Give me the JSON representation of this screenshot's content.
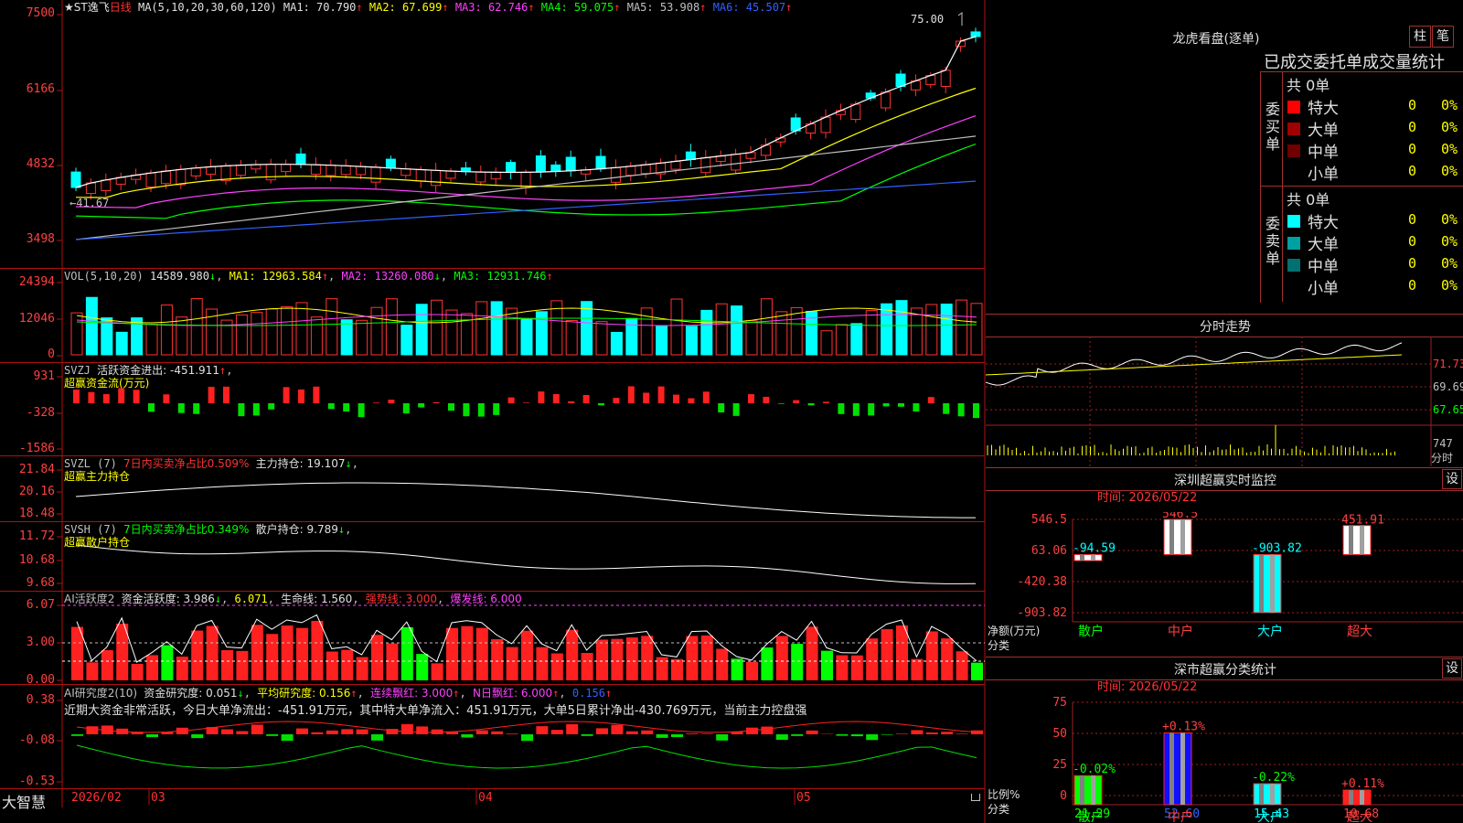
{
  "header": {
    "title": "★ST逸飞",
    "period": "日线",
    "ma_def": "MA(5,10,20,30,60,120)",
    "ma": [
      {
        "label": "MA1: 70.790",
        "arrow": "↑",
        "color": "#ffffff"
      },
      {
        "label": "MA2: 67.699",
        "arrow": "↑",
        "color": "#ffff00"
      },
      {
        "label": "MA3: 62.746",
        "arrow": "↑",
        "color": "#ff40ff"
      },
      {
        "label": "MA4: 59.075",
        "arrow": "↑",
        "color": "#00ff00"
      },
      {
        "label": "MA5: 53.908",
        "arrow": "↑",
        "color": "#c0c0c0"
      },
      {
        "label": "MA6: 45.507",
        "arrow": "↑",
        "color": "#3060ff"
      }
    ],
    "high_mark": "75.00",
    "low_mark": "←41.67"
  },
  "price_axis": [
    "7500",
    "6166",
    "4832",
    "3498"
  ],
  "vol": {
    "label": "VOL(5,10,20)",
    "value": "14589.980",
    "value_arrow": "↓",
    "ma1": "MA1: 12963.584",
    "ma1_arrow": "↑",
    "ma2": "MA2: 13260.080",
    "ma2_arrow": "↓",
    "ma3": "MA3: 12931.746",
    "ma3_arrow": "↑",
    "axis": [
      "24394",
      "12046",
      "0"
    ]
  },
  "svzj": {
    "label": "SVZJ",
    "title": "活跃资金进出: -451.911",
    "arrow": "↑",
    "sub": "超赢资金流(万元)",
    "axis": [
      "931",
      "-328",
      "-1586"
    ]
  },
  "svzl": {
    "label": "SVZL (7)",
    "desc": "7日内买卖净占比0.509%",
    "hold": "主力持仓: 19.107",
    "arrow": "↓",
    "sub": "超赢主力持仓",
    "axis": [
      "21.84",
      "20.16",
      "18.48"
    ]
  },
  "svsh": {
    "label": "SVSH (7)",
    "desc": "7日内买卖净占比0.349%",
    "hold": "散户持仓: 9.789",
    "arrow": "↓",
    "sub": "超赢散户持仓",
    "axis": [
      "11.72",
      "10.68",
      "9.68"
    ]
  },
  "ai_active": {
    "label": "AI活跃度2",
    "act": "资金活跃度: 3.986",
    "act_arrow": "↓",
    "v2": "6.071",
    "life": "生命线: 1.560",
    "strong": "强势线: 3.000",
    "burst": "爆发线: 6.000",
    "axis": [
      "6.07",
      "3.00",
      "0.00"
    ]
  },
  "ai_research": {
    "label": "AI研究度2(10)",
    "research": "资金研究度: 0.051",
    "r_arrow": "↓",
    "avg": "平均研究度: 0.156",
    "avg_arrow": "↑",
    "cont": "连续飘红: 3.000",
    "cont_arrow": "↑",
    "nday": "N日飘红: 6.000",
    "nday_arrow": "↑",
    "last": "0.156",
    "last_arrow": "↑",
    "comment": "近期大资金非常活跃，今日大单净流出：-451.91万元，其中特大单净流入：451.91万元，大单5日累计净出-430.769万元，当前主力控盘强",
    "axis": [
      "0.38",
      "-0.08",
      "-0.53"
    ]
  },
  "footer": {
    "brand": "大智慧",
    "date_labels": [
      "2026/02",
      "03",
      "04",
      "05"
    ]
  },
  "right": {
    "panel_title": "龙虎看盘(逐单)",
    "btn_bar": "柱",
    "btn_pen": "笔",
    "tabs": "已成交委托单成交量统计",
    "buy": {
      "side_label": "委买单",
      "total": "共 0单",
      "rows": [
        {
          "name": "特大",
          "count": "0",
          "pct": "0%",
          "color": "#ff0000"
        },
        {
          "name": "大单",
          "count": "0",
          "pct": "0%",
          "color": "#a00000"
        },
        {
          "name": "中单",
          "count": "0",
          "pct": "0%",
          "color": "#700000"
        },
        {
          "name": "小单",
          "count": "0",
          "pct": "0%",
          "color": "#000000"
        }
      ]
    },
    "sell": {
      "side_label": "委卖单",
      "total": "共 0单",
      "rows": [
        {
          "name": "特大",
          "count": "0",
          "pct": "0%",
          "color": "#00ffff"
        },
        {
          "name": "大单",
          "count": "0",
          "pct": "0%",
          "color": "#00a0a0"
        },
        {
          "name": "中单",
          "count": "0",
          "pct": "0%",
          "color": "#007070"
        },
        {
          "name": "小单",
          "count": "0",
          "pct": "0%",
          "color": "#000000"
        }
      ]
    },
    "intraday": {
      "title": "分时走势",
      "axis": [
        "71.73",
        "69.69",
        "67.65"
      ],
      "vol_axis": "747",
      "unit": "分时"
    },
    "sz_monitor": {
      "title": "深圳超赢实时监控",
      "btn": "设",
      "time": "时间: 2026/05/22",
      "axis": [
        "546.5",
        "63.06",
        "-420.38",
        "-903.82"
      ],
      "ylabel": "净额(万元)",
      "xlabel": "分类",
      "categories": [
        "散户",
        "中户",
        "大户",
        "超大"
      ],
      "values": [
        -94.59,
        546.5,
        -903.82,
        451.91
      ],
      "value_labels": [
        "-94.59",
        "546.5",
        "-903.82",
        "451.91"
      ]
    },
    "sz_class": {
      "title": "深市超赢分类统计",
      "btn": "设",
      "time": "时间: 2026/05/22",
      "axis": [
        "75",
        "50",
        "25",
        "0"
      ],
      "ylabel": "比例%",
      "xlabel": "分类",
      "categories": [
        "散户",
        "中户",
        "大户",
        "超大"
      ],
      "values": [
        21.29,
        52.6,
        15.43,
        10.68
      ],
      "value_labels": [
        "21.29",
        "52.60",
        "15.43",
        "10.68"
      ],
      "changes": [
        "-0.02%",
        "+0.13%",
        "-0.22%",
        "+0.11%"
      ]
    }
  }
}
